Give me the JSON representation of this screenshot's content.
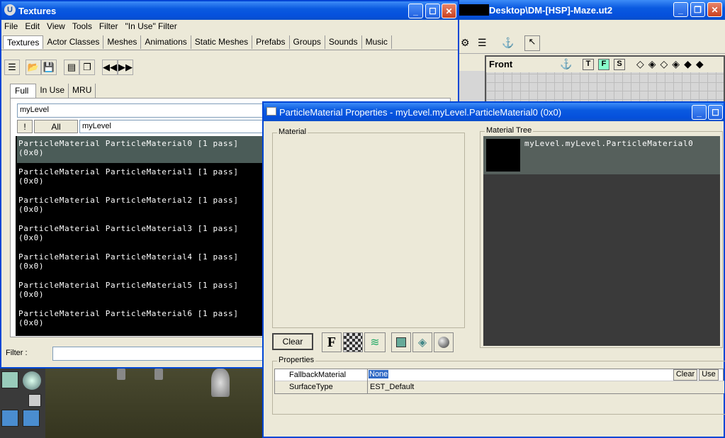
{
  "textures": {
    "title": "Textures",
    "menu": [
      "File",
      "Edit",
      "View",
      "Tools",
      "Filter",
      "\"In Use\" Filter"
    ],
    "tabs": [
      "Textures",
      "Actor Classes",
      "Meshes",
      "Animations",
      "Static Meshes",
      "Prefabs",
      "Groups",
      "Sounds",
      "Music"
    ],
    "subtabs": [
      "Full",
      "In Use",
      "MRU"
    ],
    "package": "myLevel",
    "btn_bang": "!",
    "btn_all": "All",
    "group": "myLevel",
    "items": [
      {
        "l1": "ParticleMaterial ParticleMaterial0 [1 pass]",
        "l2": "(0x0)"
      },
      {
        "l1": "ParticleMaterial ParticleMaterial1 [1 pass]",
        "l2": "(0x0)"
      },
      {
        "l1": "ParticleMaterial ParticleMaterial2 [1 pass]",
        "l2": "(0x0)"
      },
      {
        "l1": "ParticleMaterial ParticleMaterial3 [1 pass]",
        "l2": "(0x0)"
      },
      {
        "l1": "ParticleMaterial ParticleMaterial4 [1 pass]",
        "l2": "(0x0)"
      },
      {
        "l1": "ParticleMaterial ParticleMaterial5 [1 pass]",
        "l2": "(0x0)"
      },
      {
        "l1": "ParticleMaterial ParticleMaterial6 [1 pass]",
        "l2": "(0x0)"
      }
    ],
    "filter_label": "Filter :"
  },
  "editor": {
    "title": "Desktop\\DM-[HSP]-Maze.ut2",
    "viewport_label": "Front",
    "viewport_buttons": [
      "T",
      "F",
      "S"
    ]
  },
  "props": {
    "title": "ParticleMaterial Properties - myLevel.myLevel.ParticleMaterial0 (0x0)",
    "material_label": "Material",
    "tree_label": "Material Tree",
    "tree_item": "myLevel.myLevel.ParticleMaterial0",
    "clear_btn": "Clear",
    "properties_label": "Properties",
    "rows": [
      {
        "name": "FallbackMaterial",
        "value": "None"
      },
      {
        "name": "SurfaceType",
        "value": "EST_Default"
      }
    ],
    "row_clear": "Clear",
    "row_use": "Use"
  }
}
